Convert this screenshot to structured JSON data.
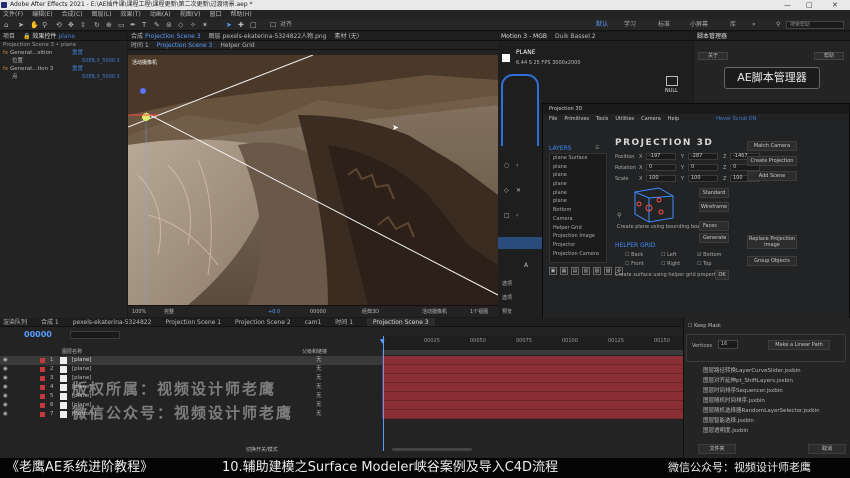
{
  "titlebar": {
    "title": "Adobe After Effects 2021 - E:\\AE插件课\\课程工程\\课程更新\\第二次更新\\过渡场景.aep *",
    "min": "—",
    "max": "□",
    "close": "✕"
  },
  "menu": [
    "文件(F)",
    "编辑(E)",
    "合成(C)",
    "图层(L)",
    "效果(T)",
    "动画(A)",
    "视图(V)",
    "窗口",
    "帮助(H)"
  ],
  "toolbar": {
    "snap": "对齐",
    "workspaces": [
      "默认",
      "学习",
      "标准",
      "小屏幕",
      "库"
    ],
    "search_placeholder": "搜索帮助"
  },
  "project_panel": {
    "tab_project": "项目",
    "tab_effects": "效果控件",
    "effects_target": "plane",
    "header": "Projection Scene 3 • plane",
    "effects": [
      {
        "name": "Generat...sition",
        "label": "重置",
        "hex": "50EB,3_5000.3"
      },
      {
        "name": "Generat...tion 3",
        "label": "重置",
        "hex": "50EB,3_5000.3"
      }
    ],
    "sub1": "位置",
    "sub2": "点"
  },
  "viewer": {
    "tab_comp": "合成",
    "comp_name": "Projection Scene 3",
    "tab_layer": "图层",
    "layer_name": "pexels-ekaterina-5324822人物.png",
    "tab_footage": "素材",
    "footage_value": "(无)",
    "subtabs": [
      "时间 1",
      "Projection Scene 3",
      "Helper Grid"
    ],
    "label": "活动摄像机",
    "bottom": [
      "100%",
      "完整",
      "+0.0",
      "00000",
      "经典3D",
      "活动摄像机",
      "1个视图"
    ],
    "bottom_right": "+0.0"
  },
  "motion_panel": {
    "tab1": "Motion 3 - MGB",
    "tab2": "Duik Bassel.2",
    "layer": "PLANE",
    "fps": "6.44 S   25 FPS   3000x2000",
    "null_label": "NULL",
    "side1": "选项",
    "side2": "选项",
    "side3": "预览"
  },
  "script_manager": {
    "title": "脚本管理器",
    "about": "关于",
    "help": "帮助",
    "logo": "AE脚本管理器"
  },
  "p3d": {
    "title": "Projection 3D",
    "menu": [
      "File",
      "Primitives",
      "Tools",
      "Utilities",
      "Camera",
      "Help"
    ],
    "hover": "Hover Scrub ON",
    "logo": "PROJECTION 3D",
    "layers_title": "LAYERS",
    "layers": [
      "plane Surface",
      "plane",
      "plane",
      "plane",
      "plane",
      "plane",
      "Bottom",
      "Camera",
      "Helper Grid",
      "Projection Image",
      "Projector",
      "Projection Camera"
    ],
    "position": {
      "label": "Position",
      "x": "-197",
      "y": "-287",
      "z": "-1467"
    },
    "rotation": {
      "label": "Rotation",
      "x": "0",
      "y": "0",
      "z": "0"
    },
    "scale": {
      "label": "Scale",
      "x": "100",
      "y": "100",
      "z": "100"
    },
    "create_plane": "Create plane using bounding box",
    "btn_match": "Match Camera",
    "btn_create_proj": "Create Projection",
    "btn_add_scene": "Add Scene",
    "btn_standard": "Standard",
    "btn_wireframe": "Wireframe",
    "sel_faces": "Faces",
    "sel_generate": "Generate",
    "btn_replace": "Replace Projection Image",
    "btn_group": "Group Objects",
    "helper_title": "HELPER GRID",
    "checks": [
      "Back",
      "Left",
      "Bottom",
      "Front",
      "Right",
      "Top"
    ],
    "create_surface": "Create surface using helper grid properties",
    "ok": "OK"
  },
  "right_lower": {
    "keep": "Keep Mask",
    "vertices_label": "Vertices",
    "vertices": "16",
    "linear_btn": "Make a Linear Path",
    "scripts": [
      "图层路径转换LayerCurveSlider.jsxbin",
      "图层对齐延伸pt_ShiftLayers.jsxbin",
      "图层时间排序Sequencer.jsxbin",
      "图层随机时间排序.jsxbin",
      "图层随机选择器RandomLayerSelector.jsxbin",
      "图层智能选择.jsxbin",
      "图层透明度.jsxbin"
    ],
    "btn_folder": "文件夹",
    "btn_cancel": "取消"
  },
  "timeline": {
    "tabs": [
      "渲染队列",
      "合成 1",
      "pexels-ekaterina-5324822",
      "Projection Scene 1",
      "Projection Scene 2",
      "cam1",
      "时间 1",
      "Projection Scene 3"
    ],
    "timecode": "00000",
    "col_name": "图层名称",
    "col_parent": "父级和链接",
    "layers": [
      {
        "n": "1",
        "name": "[plane]",
        "parent": "无"
      },
      {
        "n": "2",
        "name": "[plane]",
        "parent": "无"
      },
      {
        "n": "3",
        "name": "[plane]",
        "parent": "无"
      },
      {
        "n": "4",
        "name": "[plane]",
        "parent": "无"
      },
      {
        "n": "5",
        "name": "[plane]",
        "parent": "无"
      },
      {
        "n": "6",
        "name": "[plane]",
        "parent": "无"
      },
      {
        "n": "7",
        "name": "[Bottom]",
        "parent": "无"
      }
    ],
    "ruler": [
      "00025",
      "00050",
      "00075",
      "00100",
      "00125",
      "00150"
    ],
    "bottom": "切换开关/模式"
  },
  "watermark": {
    "line1": "版权所属：视频设计师老鹰",
    "line2": "微信公众号：视频设计师老鹰"
  },
  "footer": {
    "left": "《老鹰AE系统进阶教程》",
    "center": "10.辅助建模之Surface Modeler峡谷案例及导入C4D流程",
    "right": "微信公众号：视频设计师老鹰"
  }
}
